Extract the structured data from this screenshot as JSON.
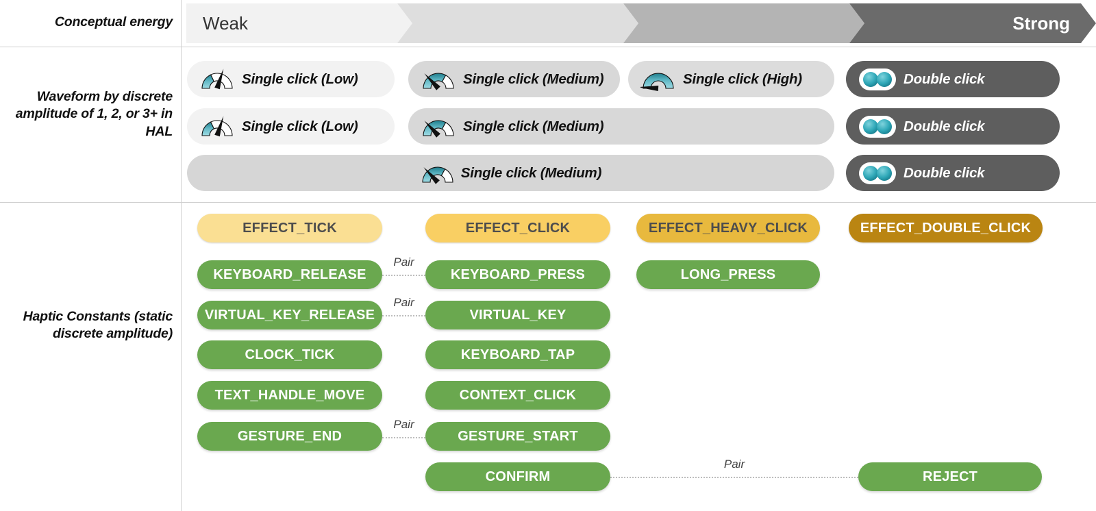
{
  "rows": {
    "energy_label": "Conceptual energy",
    "waveform_label": "Waveform by discrete amplitude of 1, 2, or 3+ in HAL",
    "haptic_label": "Haptic Constants (static discrete amplitude)"
  },
  "energy_bar": {
    "weak_label": "Weak",
    "strong_label": "Strong",
    "segments": [
      {
        "label": "Weak",
        "color": "#f2f2f2",
        "text_color": "#333333"
      },
      {
        "label": "",
        "color": "#dedede",
        "text_color": "#333333"
      },
      {
        "label": "",
        "color": "#b4b4b4",
        "text_color": "#333333"
      },
      {
        "label": "Strong",
        "color": "#6b6b6b",
        "text_color": "#ffffff"
      }
    ]
  },
  "waveforms": {
    "row1": [
      {
        "label": "Single click (Low)",
        "icon": "gauge-low-icon",
        "bg": "#f2f2f2",
        "text_color": "#111111"
      },
      {
        "label": "Single click (Medium)",
        "icon": "gauge-medium-icon",
        "bg": "#d8d8d8",
        "text_color": "#111111"
      },
      {
        "label": "Single click (High)",
        "icon": "gauge-high-icon",
        "bg": "#dcdcdc",
        "text_color": "#111111"
      },
      {
        "label": "Double click",
        "icon": "double-dot-icon",
        "bg": "#5e5e5e",
        "text_color": "#ffffff"
      }
    ],
    "row2": [
      {
        "label": "Single click (Low)",
        "icon": "gauge-low-icon",
        "bg": "#f2f2f2",
        "text_color": "#111111"
      },
      {
        "label": "Single click (Medium)",
        "icon": "gauge-medium-icon",
        "bg": "#d8d8d8",
        "text_color": "#111111"
      },
      {
        "label": "Double click",
        "icon": "double-dot-icon",
        "bg": "#5e5e5e",
        "text_color": "#ffffff"
      }
    ],
    "row3": [
      {
        "label": "Single click (Medium)",
        "icon": "gauge-medium-icon",
        "bg": "#d6d6d6",
        "text_color": "#111111"
      },
      {
        "label": "Double click",
        "icon": "double-dot-icon",
        "bg": "#5e5e5e",
        "text_color": "#ffffff"
      }
    ]
  },
  "effects": [
    {
      "label": "EFFECT_TICK",
      "bg": "#fadf93",
      "text_color": "#4d4d4d"
    },
    {
      "label": "EFFECT_CLICK",
      "bg": "#f9cf63",
      "text_color": "#4d4d4d"
    },
    {
      "label": "EFFECT_HEAVY_CLICK",
      "bg": "#e8b93e",
      "text_color": "#4d4d4d"
    },
    {
      "label": "EFFECT_DOUBLE_CLICK",
      "bg": "#ba8512",
      "text_color": "#ffffff"
    }
  ],
  "constants": {
    "col1": [
      "KEYBOARD_RELEASE",
      "VIRTUAL_KEY_RELEASE",
      "CLOCK_TICK",
      "TEXT_HANDLE_MOVE",
      "GESTURE_END"
    ],
    "col2": [
      "KEYBOARD_PRESS",
      "VIRTUAL_KEY",
      "KEYBOARD_TAP",
      "CONTEXT_CLICK",
      "GESTURE_START",
      "CONFIRM"
    ],
    "col3": [
      "LONG_PRESS"
    ],
    "col4": [
      "REJECT"
    ],
    "green_color": "#6aa84f"
  },
  "pairs": [
    {
      "label": "Pair",
      "note": "KEYBOARD_RELEASE - KEYBOARD_PRESS"
    },
    {
      "label": "Pair",
      "note": "VIRTUAL_KEY_RELEASE - VIRTUAL_KEY"
    },
    {
      "label": "Pair",
      "note": "GESTURE_END - GESTURE_START"
    },
    {
      "label": "Pair",
      "note": "CONFIRM - REJECT"
    }
  ]
}
